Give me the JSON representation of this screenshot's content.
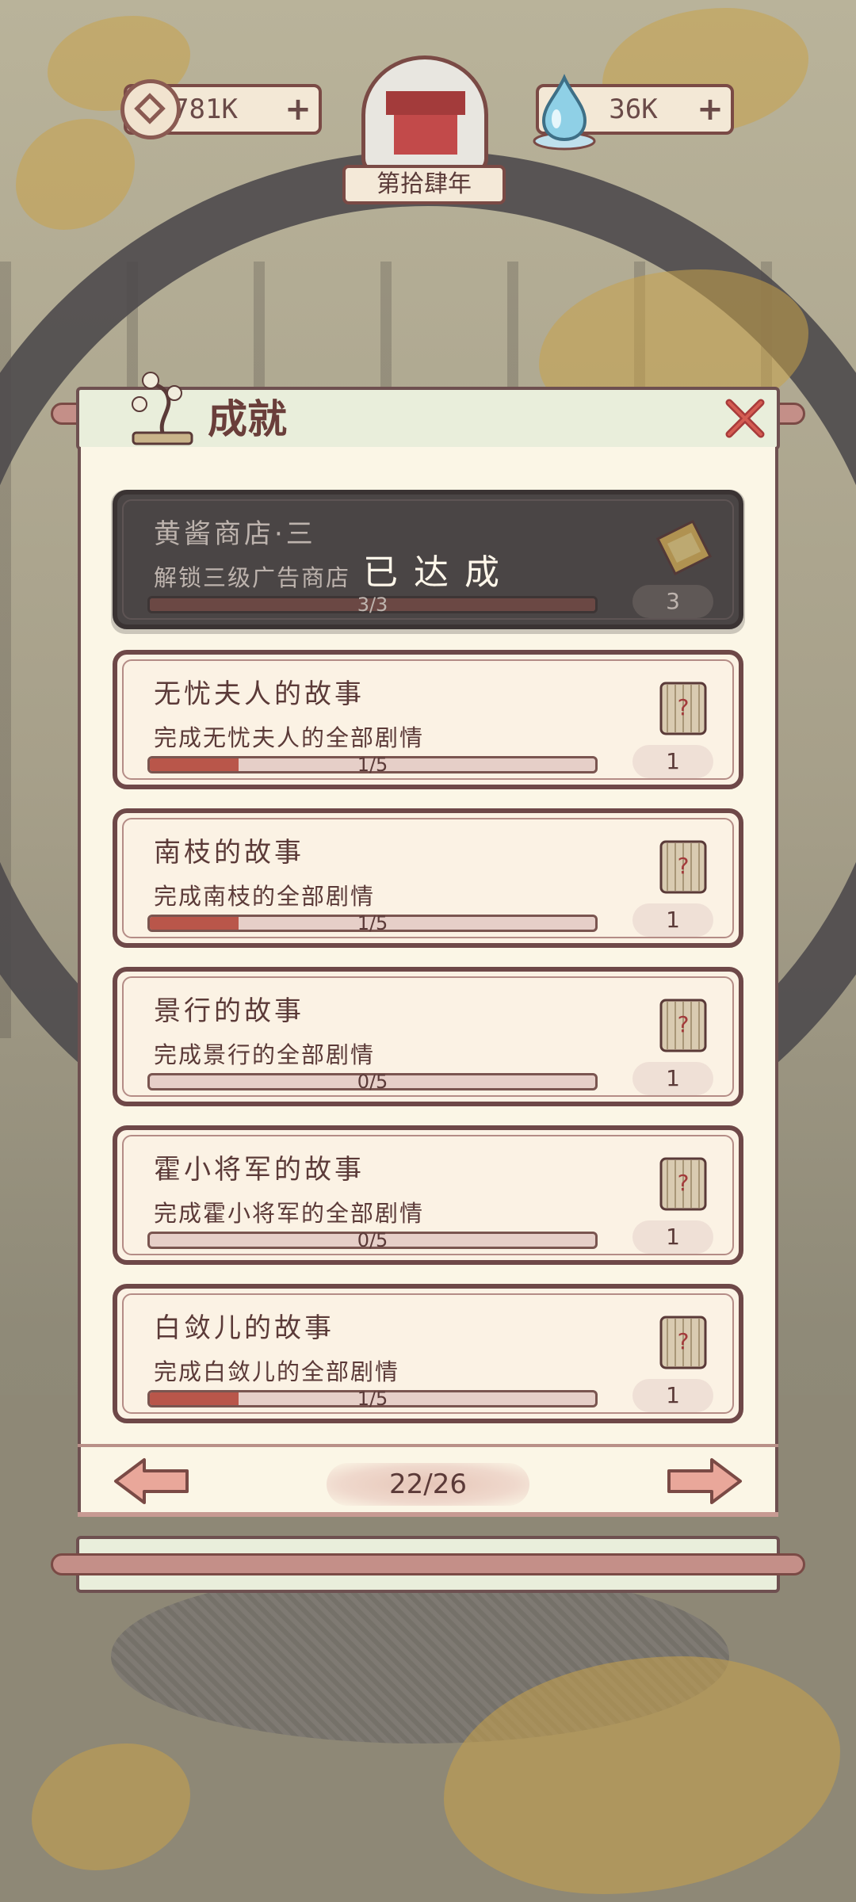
{
  "resources": {
    "coins": "781K",
    "coins_plus": "+",
    "water": "36K",
    "water_plus": "+",
    "year": "第拾肆年"
  },
  "panel": {
    "title": "成就"
  },
  "achievements": [
    {
      "name": "黄酱商店·三",
      "desc": "解锁三级广告商店",
      "progress_text": "3/3",
      "progress": 1.0,
      "reward_count": "3",
      "completed": true,
      "completed_label": "已达成",
      "reward_icon": "ticket-icon"
    },
    {
      "name": "无忧夫人的故事",
      "desc": "完成无忧夫人的全部剧情",
      "progress_text": "1/5",
      "progress": 0.2,
      "reward_count": "1",
      "completed": false,
      "reward_icon": "scroll-icon"
    },
    {
      "name": "南枝的故事",
      "desc": "完成南枝的全部剧情",
      "progress_text": "1/5",
      "progress": 0.2,
      "reward_count": "1",
      "completed": false,
      "reward_icon": "scroll-icon"
    },
    {
      "name": "景行的故事",
      "desc": "完成景行的全部剧情",
      "progress_text": "0/5",
      "progress": 0.0,
      "reward_count": "1",
      "completed": false,
      "reward_icon": "scroll-icon"
    },
    {
      "name": "霍小将军的故事",
      "desc": "完成霍小将军的全部剧情",
      "progress_text": "0/5",
      "progress": 0.0,
      "reward_count": "1",
      "completed": false,
      "reward_icon": "scroll-icon"
    },
    {
      "name": "白敛儿的故事",
      "desc": "完成白敛儿的全部剧情",
      "progress_text": "1/5",
      "progress": 0.2,
      "reward_count": "1",
      "completed": false,
      "reward_icon": "scroll-icon"
    }
  ],
  "pager": {
    "indicator": "22/26"
  },
  "colors": {
    "accent": "#b9564a",
    "panel_bg": "#fbf6e6",
    "border": "#6e4848"
  }
}
